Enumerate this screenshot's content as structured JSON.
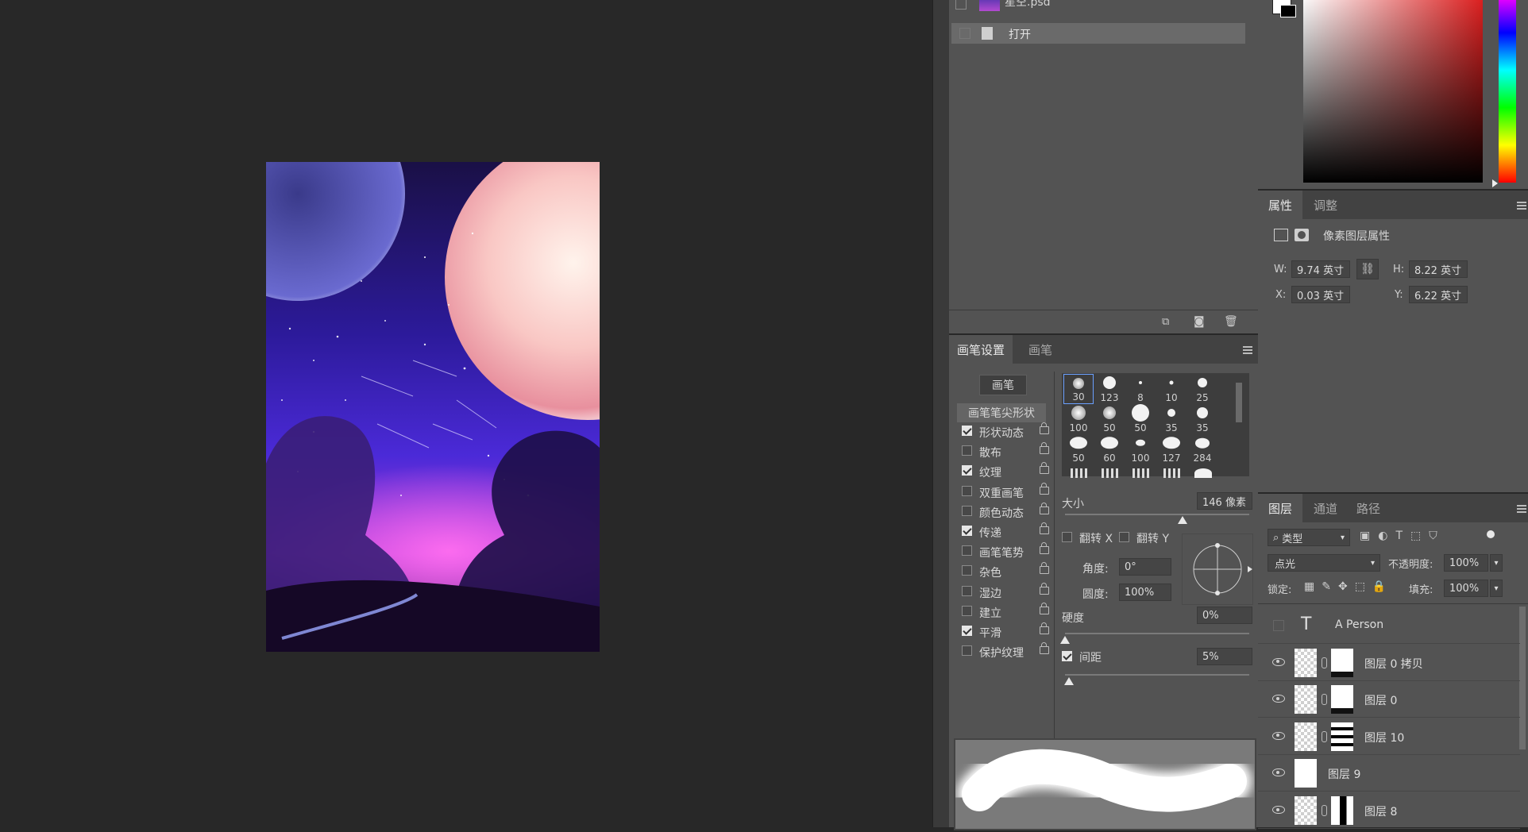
{
  "history": {
    "snapshot_name": "星空.psd",
    "items": [
      {
        "label": "打开"
      }
    ]
  },
  "brush_settings": {
    "tabs": [
      "画笔设置",
      "画笔"
    ],
    "brush_button": "画笔",
    "tip_shape_label": "画笔笔尖形状",
    "options": [
      {
        "label": "形状动态",
        "checked": true
      },
      {
        "label": "散布",
        "checked": false
      },
      {
        "label": "纹理",
        "checked": true
      },
      {
        "label": "双重画笔",
        "checked": false
      },
      {
        "label": "颜色动态",
        "checked": false
      },
      {
        "label": "传递",
        "checked": true
      },
      {
        "label": "画笔笔势",
        "checked": false
      },
      {
        "label": "杂色",
        "checked": false
      },
      {
        "label": "湿边",
        "checked": false
      },
      {
        "label": "建立",
        "checked": false
      },
      {
        "label": "平滑",
        "checked": true
      },
      {
        "label": "保护纹理",
        "checked": false
      }
    ],
    "tip_sizes": [
      "30",
      "123",
      "8",
      "10",
      "25",
      "100",
      "50",
      "50",
      "35",
      "35",
      "50",
      "60",
      "100",
      "127",
      "284"
    ],
    "size_label": "大小",
    "size_value": "146 像素",
    "flip_x": "翻转 X",
    "flip_y": "翻转 Y",
    "angle_label": "角度:",
    "angle_value": "0°",
    "roundness_label": "圆度:",
    "roundness_value": "100%",
    "hardness_label": "硬度",
    "hardness_value": "0%",
    "spacing_label": "间距",
    "spacing_value": "5%",
    "spacing_checked": true
  },
  "properties": {
    "tabs": [
      "属性",
      "调整"
    ],
    "header": "像素图层属性",
    "w_label": "W:",
    "w_value": "9.74 英寸",
    "h_label": "H:",
    "h_value": "8.22 英寸",
    "x_label": "X:",
    "x_value": "0.03 英寸",
    "y_label": "Y:",
    "y_value": "6.22 英寸"
  },
  "layers": {
    "tabs": [
      "图层",
      "通道",
      "路径"
    ],
    "filter_label": "类型",
    "blend_mode": "点光",
    "opacity_label": "不透明度:",
    "opacity_value": "100%",
    "lock_label": "锁定:",
    "fill_label": "填充:",
    "fill_value": "100%",
    "items": [
      {
        "name": "A Person",
        "type": "text",
        "visible": false
      },
      {
        "name": "图层 0 拷贝",
        "type": "masked",
        "visible": true
      },
      {
        "name": "图层 0",
        "type": "masked",
        "visible": true
      },
      {
        "name": "图层 10",
        "type": "masked",
        "visible": true
      },
      {
        "name": "图层 9",
        "type": "plain",
        "visible": true
      },
      {
        "name": "图层 8",
        "type": "masked",
        "visible": true
      }
    ]
  },
  "colors": {
    "panel_bg": "#535353",
    "canvas_bg": "#282828"
  }
}
